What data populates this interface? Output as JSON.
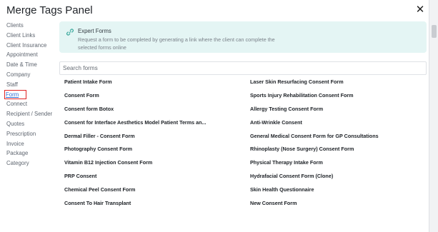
{
  "panel": {
    "title": "Merge Tags Panel",
    "close_glyph": "✕"
  },
  "sidebar": {
    "items": [
      {
        "label": "Clients"
      },
      {
        "label": "Client Links"
      },
      {
        "label": "Client Insurance"
      },
      {
        "label": "Appointment"
      },
      {
        "label": "Date & Time"
      },
      {
        "label": "Company"
      },
      {
        "label": "Staff"
      },
      {
        "label": "Form"
      },
      {
        "label": "Connect"
      },
      {
        "label": "Recipient / Sender"
      },
      {
        "label": "Quotes"
      },
      {
        "label": "Prescription"
      },
      {
        "label": "Invoice"
      },
      {
        "label": "Package"
      },
      {
        "label": "Category"
      }
    ],
    "active": "Form"
  },
  "banner": {
    "icon": "link-icon",
    "title": "Expert Forms",
    "text": "Request a form to be completed by generating a link where the client can complete the selected forms online",
    "color": "#e4f5f4"
  },
  "search": {
    "placeholder": "Search forms",
    "value": ""
  },
  "forms": {
    "left": [
      "Patient Intake Form",
      "Consent Form",
      "Consent form Botox",
      "Consent for Interface Aesthetics Model Patient Terms an...",
      "Dermal Filler - Consent Form",
      "Photography Consent Form",
      "Vitamin B12 Injection Consent Form",
      "PRP Consent",
      "Chemical Peel Consent Form",
      "Consent To Hair Transplant"
    ],
    "right": [
      "Laser Skin Resurfacing Consent Form",
      "Sports Injury Rehabilitation Consent Form",
      "Allergy Testing Consent Form",
      "Anti-Wrinkle Consent",
      "General Medical Consent Form for GP Consultations",
      "Rhinoplasty (Nose Surgery) Consent Form",
      "Physical Therapy Intake Form",
      "Hydrafacial Consent Form (Clone)",
      "Skin Health Questionnaire",
      "New Consent Form"
    ]
  },
  "colors": {
    "accent": "#2f6fd6",
    "highlight": "#e02424"
  }
}
